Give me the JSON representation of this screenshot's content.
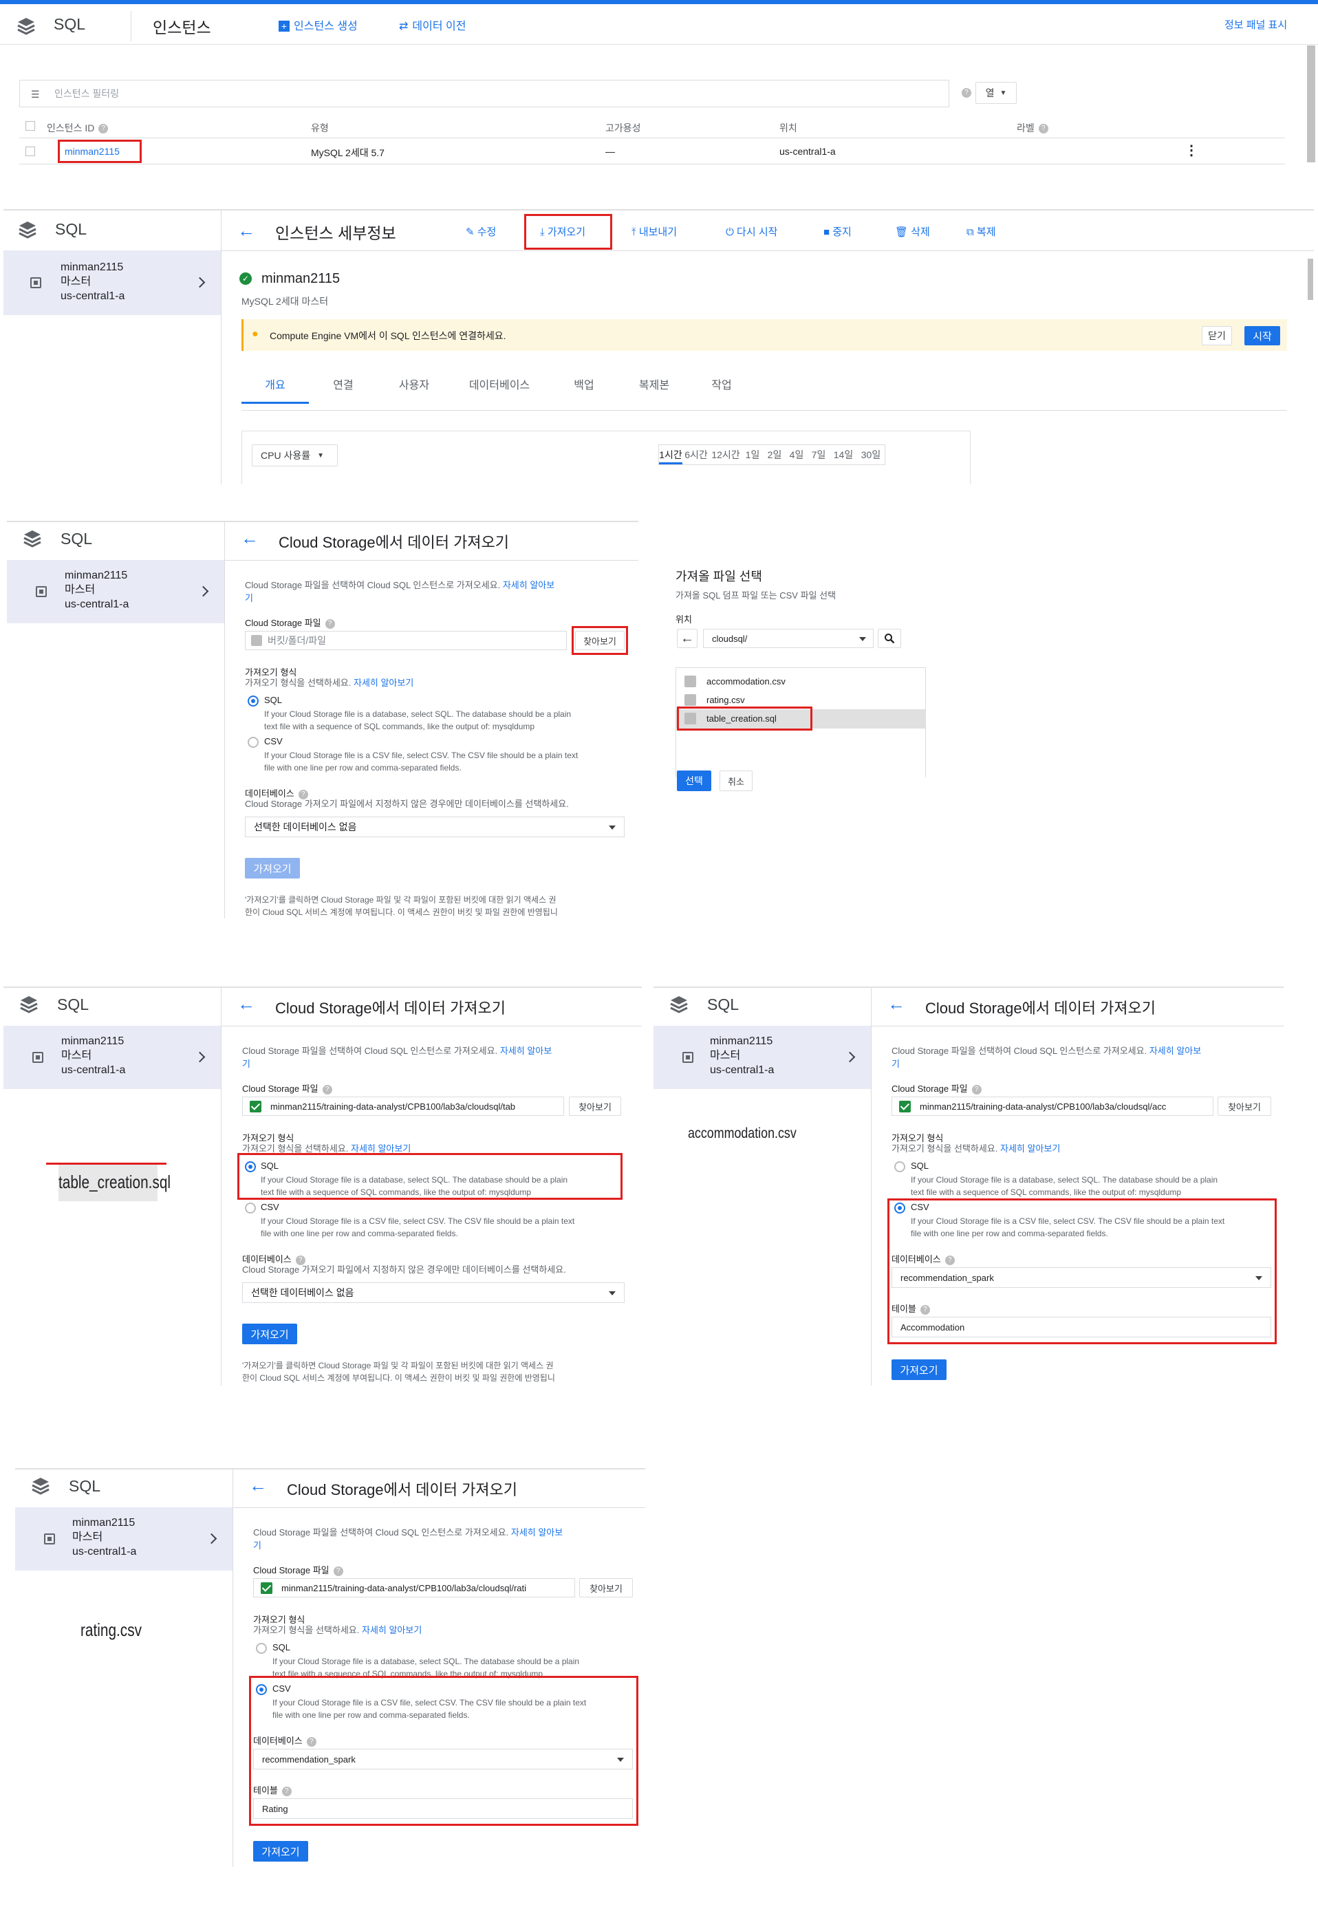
{
  "colors": {
    "accent": "#1a73e8",
    "highlight_box": "#e02020",
    "sidebar": "#e8eaf6",
    "success": "#1e8e3e"
  },
  "p1": {
    "app": "SQL",
    "title": "인스턴스",
    "create": "인스턴스 생성",
    "migrate": "데이터 이전",
    "info_panel": "정보 패널 표시",
    "filter_placeholder": "인스턴스 필터링",
    "columns_btn": "열",
    "headers": {
      "id": "인스턴스 ID",
      "type": "유형",
      "ha": "고가용성",
      "location": "위치",
      "labels": "라벨"
    },
    "row": {
      "id": "minman2115",
      "type": "MySQL 2세대 5.7",
      "ha": "—",
      "location": "us-central1-a"
    }
  },
  "p2": {
    "app": "SQL",
    "title": "인스턴스 세부정보",
    "actions": {
      "edit": "수정",
      "import": "가져오기",
      "export": "내보내기",
      "restart": "다시 시작",
      "stop": "중지",
      "delete": "삭제",
      "clone": "복제"
    },
    "side": {
      "l1": "minman2115",
      "l2": "마스터",
      "l3": "us-central1-a"
    },
    "instance_name": "minman2115",
    "instance_sub": "MySQL 2세대 마스터",
    "banner": "Compute Engine VM에서 이 SQL 인스턴스에 연결하세요.",
    "close": "닫기",
    "start": "시작",
    "tabs": [
      "개요",
      "연결",
      "사용자",
      "데이터베이스",
      "백업",
      "복제본",
      "작업"
    ],
    "metric": "CPU 사용률",
    "ranges": [
      "1시간",
      "6시간",
      "12시간",
      "1일",
      "2일",
      "4일",
      "7일",
      "14일",
      "30일"
    ]
  },
  "form": {
    "app": "SQL",
    "title": "Cloud Storage에서 데이터 가져오기",
    "intro": "Cloud Storage 파일을 선택하여 Cloud SQL 인스턴스로 가져오세요.",
    "learn": "자세히 알아보",
    "learn_tail": "기",
    "file_label": "Cloud Storage 파일",
    "file_placeholder": "버킷/폴더/파일",
    "browse": "찾아보기",
    "format_label": "가져오기 형식",
    "format_hint": "가져오기 형식을 선택하세요.",
    "learn_more": "자세히 알아보기",
    "sql": "SQL",
    "sql_desc1": "If your Cloud Storage file is a database, select SQL. The database should be a plain",
    "sql_desc2": "text file with a sequence of SQL commands, like the output of: mysqldump",
    "csv": "CSV",
    "csv_desc1": "If your Cloud Storage file is a CSV file, select CSV. The CSV file should be a plain text",
    "csv_desc2": "file with one line per row and comma-separated fields.",
    "db_label": "데이터베이스",
    "db_hint": "Cloud Storage 가져오기 파일에서 지정하지 않은 경우에만 데이터베이스를 선택하세요.",
    "db_none": "선택한 데이터베이스 없음",
    "import_btn": "가져오기",
    "note1": "'가져오기'를 클릭하면 Cloud Storage 파일 및 각 파일이 포함된 버킷에 대한 읽기 액세스 권",
    "note2": "한이 Cloud SQL 서비스 계정에 부여됩니다. 이 액세스 권한이 버킷 및 파일 권한에 반영됩니",
    "table_label": "테이블"
  },
  "picker": {
    "title": "가져올 파일 선택",
    "subtitle": "가져올 SQL 덤프 파일 또는 CSV 파일 선택",
    "location": "위치",
    "path": "cloudsql/",
    "files": [
      "accommodation.csv",
      "rating.csv",
      "table_creation.sql"
    ],
    "select": "선택",
    "cancel": "취소"
  },
  "p4": {
    "caption": "table_creation.sql",
    "path": "minman2115/training-data-analyst/CPB100/lab3a/cloudsql/tab"
  },
  "p5": {
    "caption": "accommodation.csv",
    "path": "minman2115/training-data-analyst/CPB100/lab3a/cloudsql/acc",
    "db": "recommendation_spark",
    "table": "Accommodation"
  },
  "p6": {
    "caption": "rating.csv",
    "path": "minman2115/training-data-analyst/CPB100/lab3a/cloudsql/rati",
    "db": "recommendation_spark",
    "table": "Rating"
  }
}
